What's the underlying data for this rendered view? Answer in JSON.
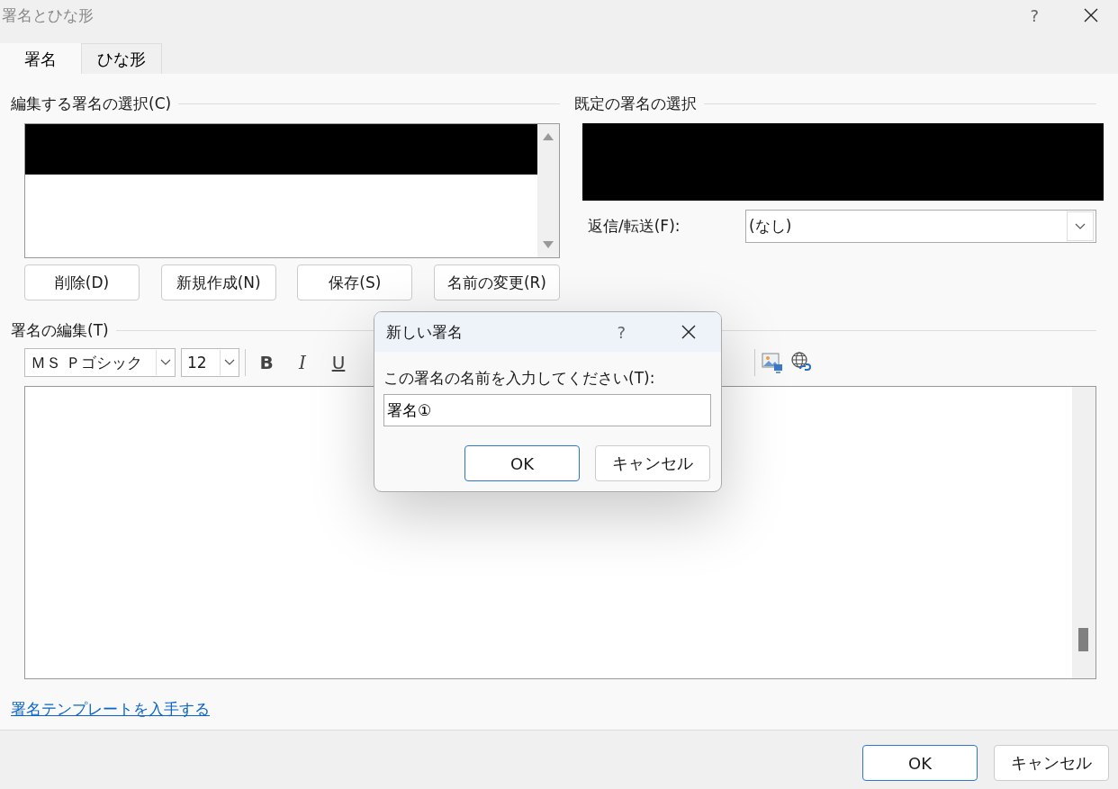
{
  "window": {
    "title": "署名とひな形",
    "help": "?"
  },
  "tabs": [
    {
      "label": "署名",
      "selected": true
    },
    {
      "label": "ひな形",
      "selected": false
    }
  ],
  "edit_select": {
    "label": "編集する署名の選択(C)",
    "buttons": [
      "削除(D)",
      "新規作成(N)",
      "保存(S)",
      "名前の変更(R)"
    ]
  },
  "default_select": {
    "label": "既定の署名の選択",
    "reply_forward": {
      "label": "返信/転送(F):",
      "value": "(なし)"
    }
  },
  "editor": {
    "label": "署名の編集(T)",
    "font": "ＭＳ Ｐゴシック",
    "size": "12",
    "format_buttons": [
      {
        "label": "B",
        "kind": "bold"
      },
      {
        "label": "I",
        "kind": "italic"
      },
      {
        "label": "U",
        "kind": "underline"
      }
    ]
  },
  "link": "署名テンプレートを入手する",
  "footer_buttons": [
    {
      "label": "OK",
      "default": true
    },
    {
      "label": "キャンセル",
      "default": false
    }
  ],
  "modal": {
    "title": "新しい署名",
    "help": "?",
    "prompt": "この署名の名前を入力してください(T):",
    "value": "署名①",
    "buttons": [
      {
        "label": "OK",
        "default": true
      },
      {
        "label": "キャンセル",
        "default": false
      }
    ]
  }
}
